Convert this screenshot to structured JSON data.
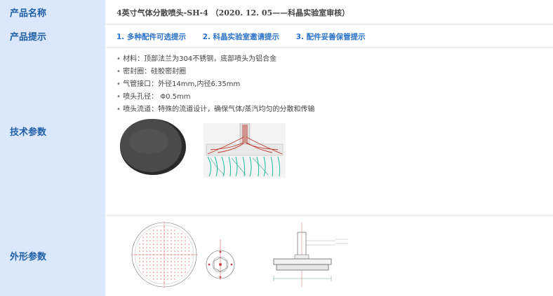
{
  "rows": {
    "name": {
      "label": "产品名称",
      "value": "4英寸气体分散喷头-SH-4  （2020. 12. 05——科晶实验室审核）"
    },
    "tips": {
      "label": "产品提示",
      "items": [
        "1. 多种配件可选提示",
        "2. 科晶实验室邀请提示",
        "3. 配件妥善保管提示"
      ]
    },
    "tech": {
      "label": "技术参数",
      "specs": [
        "材料：顶部法兰为304不锈钢，底部喷头为铝合金",
        "密封圈：硅胶密封圈",
        "气管接口：外径14mm,内径6.35mm",
        "喷头孔径： Φ0.5mm",
        "喷头流道：特殊的流道设计，确保气体/蒸汽均匀的分散和传输"
      ]
    },
    "shape": {
      "label": "外形参数"
    }
  },
  "colors": {
    "label_bg": "#dbe8fb",
    "label_text": "#1f5fa8",
    "tip_text": "#2a72c8"
  }
}
